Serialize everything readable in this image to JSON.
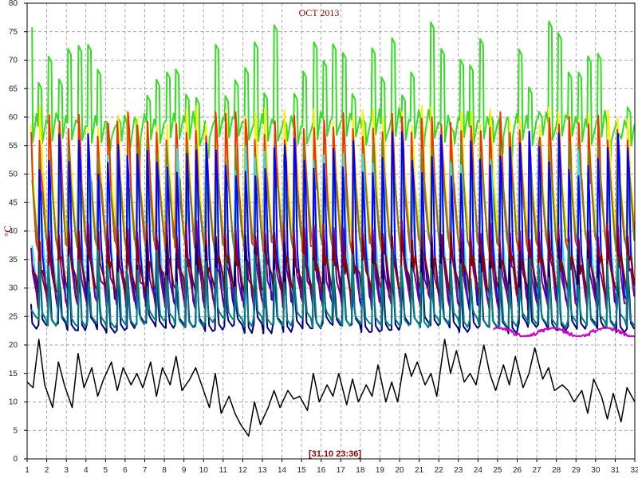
{
  "chart_data": {
    "type": "line",
    "title": "OCT 2013",
    "ylabel": "°C",
    "xlabel": "",
    "status_text": "[31.10 23:36]",
    "xlim": [
      1,
      32
    ],
    "ylim": [
      0,
      80
    ],
    "xticks": [
      "1",
      "2",
      "3",
      "4",
      "5",
      "6",
      "7",
      "8",
      "9",
      "10",
      "11",
      "12",
      "13",
      "14",
      "15",
      "16",
      "17",
      "18",
      "19",
      "20",
      "21",
      "22",
      "23",
      "24",
      "25",
      "26",
      "27",
      "28",
      "29",
      "30",
      "31",
      "32"
    ],
    "yticks": [
      "0",
      "5",
      "10",
      "15",
      "20",
      "25",
      "30",
      "35",
      "40",
      "45",
      "50",
      "55",
      "60",
      "65",
      "70",
      "75",
      "80"
    ],
    "grid": true,
    "colors": {
      "background": "#ffffff",
      "grid": "#8a8a8a",
      "axis": "#000000"
    },
    "series": [
      {
        "color": "#33dd22",
        "low": 55,
        "high": 77,
        "minF": 5,
        "pattern": "spike",
        "x": [
          1.2,
          32
        ]
      },
      {
        "color": "#ffee00",
        "low": 38,
        "high": 62,
        "minF": 48,
        "pattern": "rise",
        "x": [
          1.2,
          32
        ]
      },
      {
        "color": "#ee3300",
        "low": 36,
        "high": 61,
        "minF": 46,
        "pattern": "rise",
        "x": [
          1.2,
          32
        ]
      },
      {
        "color": "#808020",
        "low": 36,
        "high": 56,
        "minF": 46,
        "pattern": "rise",
        "x": [
          1.2,
          32
        ]
      },
      {
        "color": "#33ddee",
        "low": 27,
        "high": 55,
        "minF": 36,
        "pattern": "rise",
        "x": [
          1.2,
          32
        ]
      },
      {
        "color": "#0000ff",
        "low": 26,
        "high": 58,
        "minF": 34,
        "pattern": "rise",
        "x": [
          1.2,
          32
        ]
      },
      {
        "color": "#800080",
        "low": 26,
        "high": 42,
        "minF": 31,
        "pattern": "rise",
        "x": [
          1.2,
          32
        ]
      },
      {
        "color": "#8b0000",
        "low": 28,
        "high": 40,
        "minF": 33,
        "pattern": "rise",
        "x": [
          1.2,
          32
        ]
      },
      {
        "color": "#000080",
        "low": 22,
        "high": 40,
        "minF": 25,
        "pattern": "valley",
        "x": [
          1.2,
          32
        ]
      },
      {
        "color": "#008080",
        "low": 23,
        "high": 38,
        "minF": 26,
        "pattern": "valley",
        "x": [
          1.2,
          32
        ]
      },
      {
        "color": "#cc00cc",
        "low": 21.5,
        "high": 23,
        "minF": 0,
        "pattern": "flat",
        "x": [
          24.8,
          32
        ]
      }
    ],
    "outdoor": {
      "color": "#000000",
      "x": [
        1,
        1.3,
        1.6,
        1.9,
        2.3,
        2.6,
        2.9,
        3.3,
        3.6,
        3.9,
        4.3,
        4.6,
        4.9,
        5.3,
        5.6,
        5.9,
        6.3,
        6.6,
        6.9,
        7.3,
        7.6,
        7.9,
        8.3,
        8.6,
        8.9,
        9.3,
        9.6,
        9.9,
        10.3,
        10.6,
        10.9,
        11.3,
        11.6,
        11.9,
        12.3,
        12.6,
        12.9,
        13.3,
        13.6,
        13.9,
        14.3,
        14.6,
        14.9,
        15.3,
        15.6,
        15.9,
        16.3,
        16.6,
        16.9,
        17.3,
        17.6,
        17.9,
        18.3,
        18.6,
        18.9,
        19.3,
        19.6,
        19.9,
        20.3,
        20.6,
        20.9,
        21.3,
        21.6,
        21.9,
        22.3,
        22.6,
        22.9,
        23.3,
        23.6,
        23.9,
        24.3,
        24.6,
        24.9,
        25.3,
        25.6,
        25.9,
        26.3,
        26.6,
        26.9,
        27.3,
        27.6,
        27.9,
        28.3,
        28.6,
        28.9,
        29.3,
        29.6,
        29.9,
        30.3,
        30.6,
        30.9,
        31.3,
        31.6,
        32
      ],
      "y": [
        13.5,
        12.5,
        21,
        13,
        9,
        17,
        13,
        9,
        18.5,
        12.5,
        16,
        11,
        14,
        17,
        12,
        16,
        13,
        15,
        12.5,
        17,
        11,
        16,
        13,
        18,
        12,
        14,
        16,
        13,
        9,
        15,
        8,
        11,
        8,
        6,
        4,
        10,
        6,
        9,
        12,
        9,
        12,
        10.5,
        11,
        8.5,
        15,
        10,
        13,
        11,
        15,
        9.5,
        14,
        10,
        13,
        11,
        16.5,
        10,
        13.5,
        10,
        18.5,
        14.5,
        17,
        13,
        15,
        11,
        21,
        15,
        19,
        13.5,
        15,
        13,
        20,
        15,
        12,
        16.5,
        13,
        18,
        12.5,
        15,
        19.5,
        14,
        16,
        12,
        13,
        12,
        10,
        12,
        8,
        14,
        11,
        7,
        11.5,
        6.5,
        12.5,
        10
      ]
    }
  }
}
